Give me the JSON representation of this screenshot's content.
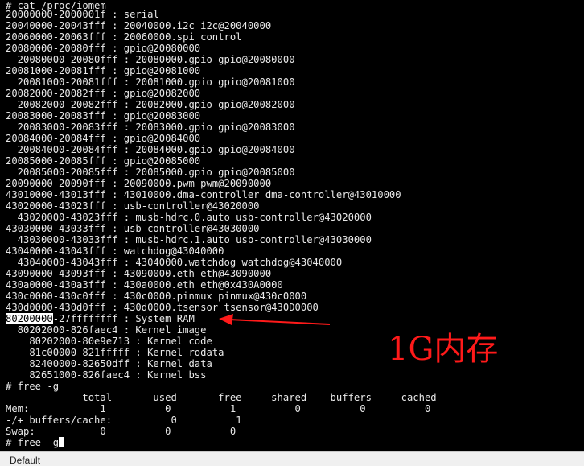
{
  "terminal": {
    "lines": [
      "# cat /proc/iomem",
      "20000000-2000001f : serial",
      "20040000-20043fff : 20040000.i2c i2c@20040000",
      "20060000-20063fff : 20060000.spi control",
      "20080000-20080fff : gpio@20080000",
      "  20080000-20080fff : 20080000.gpio gpio@20080000",
      "20081000-20081fff : gpio@20081000",
      "  20081000-20081fff : 20081000.gpio gpio@20081000",
      "20082000-20082fff : gpio@20082000",
      "  20082000-20082fff : 20082000.gpio gpio@20082000",
      "20083000-20083fff : gpio@20083000",
      "  20083000-20083fff : 20083000.gpio gpio@20083000",
      "20084000-20084fff : gpio@20084000",
      "  20084000-20084fff : 20084000.gpio gpio@20084000",
      "20085000-20085fff : gpio@20085000",
      "  20085000-20085fff : 20085000.gpio gpio@20085000",
      "20090000-20090fff : 20090000.pwm pwm@20090000",
      "43010000-43013fff : 43010000.dma-controller dma-controller@43010000",
      "43020000-43023fff : usb-controller@43020000",
      "  43020000-43023fff : musb-hdrc.0.auto usb-controller@43020000",
      "43030000-43033fff : usb-controller@43030000",
      "  43030000-43033fff : musb-hdrc.1.auto usb-controller@43030000",
      "43040000-43043fff : watchdog@43040000",
      "  43040000-43043fff : 43040000.watchdog watchdog@43040000",
      "43090000-43093fff : 43090000.eth eth@43090000",
      "430a0000-430a3fff : 430a0000.eth eth@0x430A0000",
      "430c0000-430c0fff : 430c0000.pinmux pinmux@430c0000",
      "430d0000-430d0fff : 430d0000.tsensor tsensor@430D0000"
    ],
    "ram_line": {
      "highlighted": "80200000",
      "rest": "-27ffffffff : System RAM"
    },
    "lines2": [
      "  80202000-826faec4 : Kernel image",
      "    80202000-80e9e713 : Kernel code",
      "    81c00000-821fffff : Kernel rodata",
      "    82400000-82650dff : Kernel data",
      "    82651000-826faec4 : Kernel bss",
      "# free -g",
      "             total       used       free     shared    buffers     cached",
      "Mem:            1          0          1          0          0          0",
      "-/+ buffers/cache:          0          1",
      "Swap:           0          0          0"
    ],
    "prompt": "# free -g"
  },
  "annotation": {
    "label": "1G内存",
    "color": "#ff1a1a"
  },
  "status_bar": {
    "text": "Default"
  }
}
